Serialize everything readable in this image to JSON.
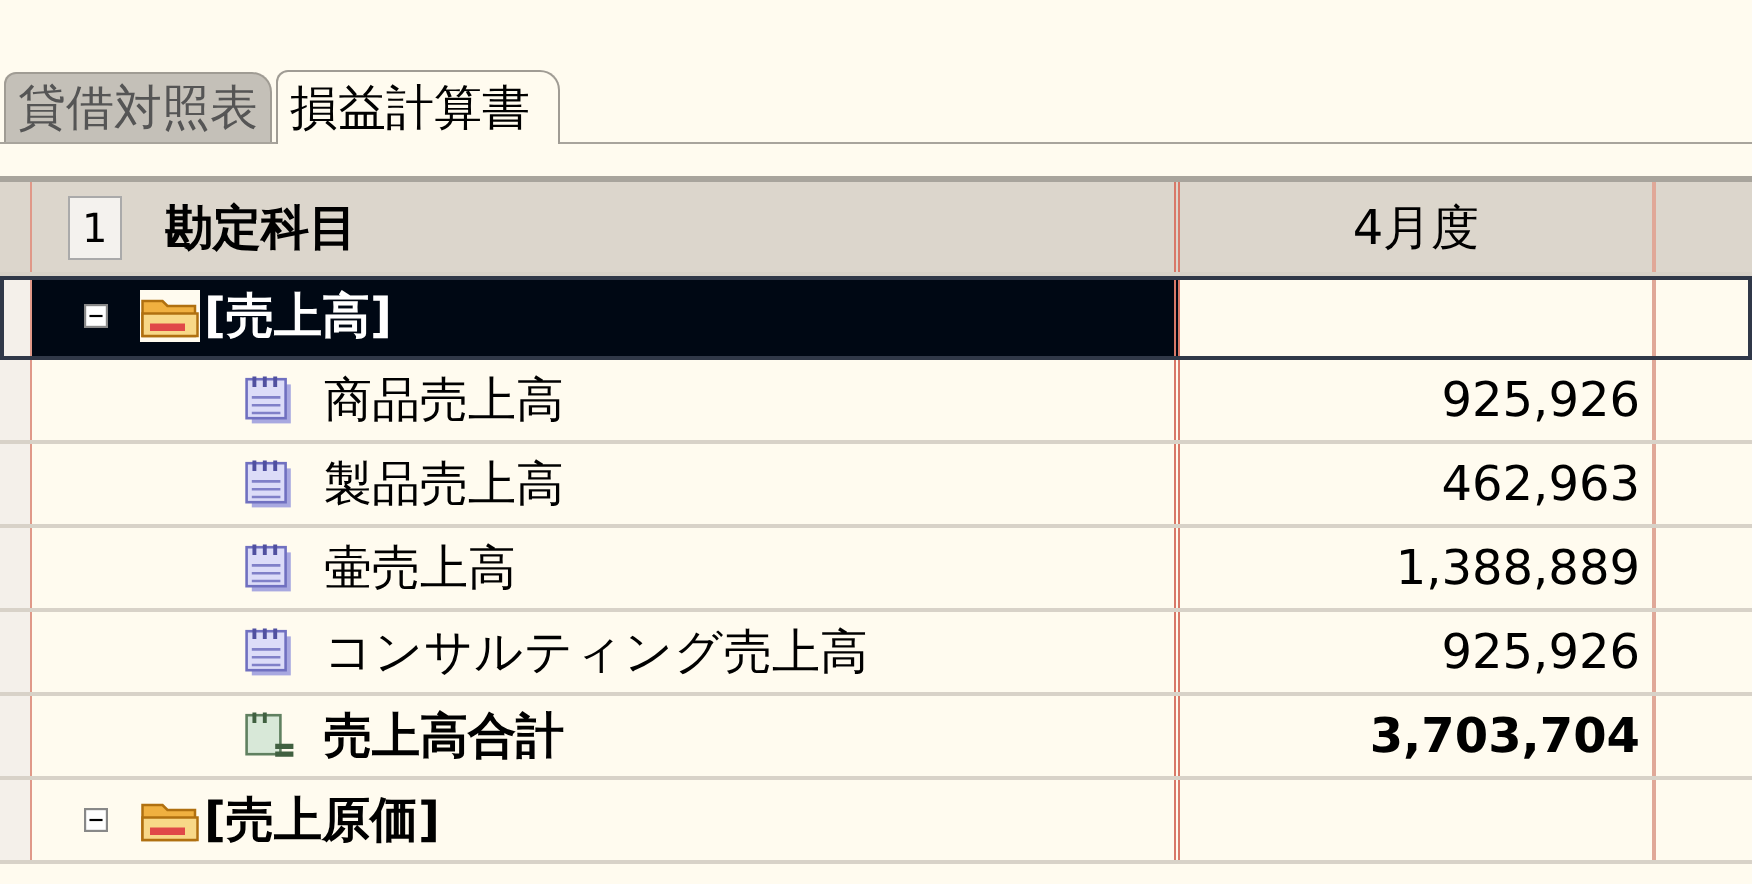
{
  "tabs": [
    {
      "label": "貸借対照表",
      "selected": false
    },
    {
      "label": "損益計算書",
      "selected": true
    }
  ],
  "grid": {
    "row_number": "1",
    "columns": [
      "勘定科目",
      "4月度"
    ],
    "rows": [
      {
        "label": "[売上高]",
        "expanded": true,
        "selected": true,
        "children": [
          {
            "kind": "item",
            "label": "商品売上高",
            "value": "925,926"
          },
          {
            "kind": "item",
            "label": "製品売上高",
            "value": "462,963"
          },
          {
            "kind": "item",
            "label": "壷売上高",
            "value": "1,388,889"
          },
          {
            "kind": "item",
            "label": "コンサルティング売上高",
            "value": "925,926"
          },
          {
            "kind": "total",
            "label": "売上高合計",
            "value": "3,703,704"
          }
        ]
      },
      {
        "label": "[売上原価]",
        "expanded": true,
        "selected": false,
        "children": []
      }
    ]
  }
}
